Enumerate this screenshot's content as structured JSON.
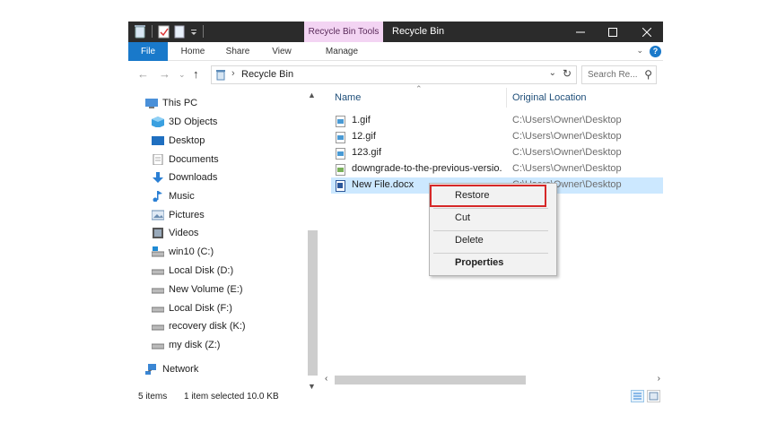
{
  "window": {
    "context_tab": "Recycle Bin Tools",
    "title": "Recycle Bin"
  },
  "ribbon": {
    "tabs": [
      "File",
      "Home",
      "Share",
      "View",
      "Manage"
    ],
    "help": "?"
  },
  "address": {
    "location": "Recycle Bin",
    "search_placeholder": "Search Re..."
  },
  "nav_pane": {
    "items": [
      {
        "label": "This PC",
        "icon": "this-pc-icon"
      },
      {
        "label": "3D Objects",
        "icon": "3d-objects-icon"
      },
      {
        "label": "Desktop",
        "icon": "desktop-icon"
      },
      {
        "label": "Documents",
        "icon": "documents-icon"
      },
      {
        "label": "Downloads",
        "icon": "downloads-icon"
      },
      {
        "label": "Music",
        "icon": "music-icon"
      },
      {
        "label": "Pictures",
        "icon": "pictures-icon"
      },
      {
        "label": "Videos",
        "icon": "videos-icon"
      },
      {
        "label": "win10 (C:)",
        "icon": "drive-icon"
      },
      {
        "label": "Local Disk (D:)",
        "icon": "drive-icon"
      },
      {
        "label": "New Volume (E:)",
        "icon": "drive-icon"
      },
      {
        "label": "Local Disk (F:)",
        "icon": "drive-icon"
      },
      {
        "label": "recovery disk (K:)",
        "icon": "drive-icon"
      },
      {
        "label": "my disk (Z:)",
        "icon": "drive-icon"
      },
      {
        "label": "Network",
        "icon": "network-icon"
      }
    ]
  },
  "columns": {
    "name": "Name",
    "original_location": "Original Location"
  },
  "files": [
    {
      "name": "1.gif",
      "location": "C:\\Users\\Owner\\Desktop"
    },
    {
      "name": "12.gif",
      "location": "C:\\Users\\Owner\\Desktop"
    },
    {
      "name": "123.gif",
      "location": "C:\\Users\\Owner\\Desktop"
    },
    {
      "name": "downgrade-to-the-previous-versio...",
      "location": "C:\\Users\\Owner\\Desktop"
    },
    {
      "name": "New File.docx",
      "location": "C:\\Users\\Owner\\Desktop"
    }
  ],
  "context_menu": {
    "items": [
      "Restore",
      "Cut",
      "Delete",
      "Properties"
    ]
  },
  "status": {
    "item_count": "5 items",
    "selection": "1 item selected  10.0 KB"
  },
  "colors": {
    "accent": "#1979ca",
    "selection": "#cce8ff",
    "highlight_box": "#d62828",
    "titlebar": "#2b2b2b"
  }
}
